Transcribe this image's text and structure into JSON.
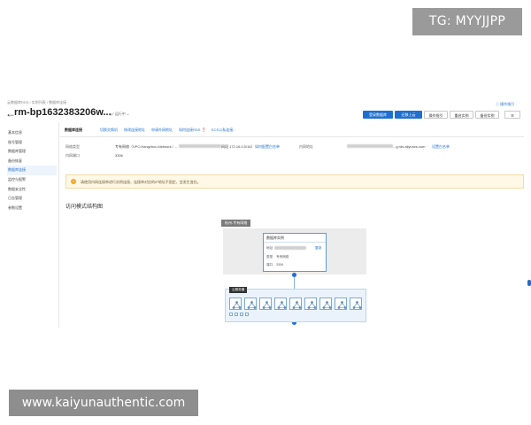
{
  "watermark": {
    "top": "TG: MYYJJPP",
    "bottom": "www.kaiyunauthentic.com"
  },
  "header": {
    "breadcrumb": "云数据库RDS / 实例列表 / 数据库连接",
    "instance_id": "rm-bp1632383206w...",
    "status": "运行中",
    "help": "操作指引"
  },
  "toolbar": {
    "buttons": [
      {
        "label": "登录数据库",
        "style": "primary"
      },
      {
        "label": "迁移上云",
        "style": "primary"
      },
      {
        "label": "操作指引",
        "style": "default"
      },
      {
        "label": "重启实例",
        "style": "default"
      },
      {
        "label": "备份实例",
        "style": "default"
      },
      {
        "label": "☰",
        "style": "default"
      }
    ]
  },
  "sidebar": {
    "items": [
      {
        "label": "基本信息",
        "active": false
      },
      {
        "label": "账号管理",
        "active": false
      },
      {
        "label": "数据库管理",
        "active": false
      },
      {
        "label": "备份恢复",
        "active": false
      },
      {
        "label": "数据库连接",
        "active": true
      },
      {
        "label": "监控与报警",
        "active": false
      },
      {
        "label": "数据安全性",
        "active": false
      },
      {
        "label": "日志管理",
        "active": false
      },
      {
        "label": "参数设置",
        "active": false
      }
    ]
  },
  "tabs": [
    {
      "label": "数据库连接",
      "active": true
    },
    {
      "label": "切换交换机",
      "active": false
    },
    {
      "label": "修改连接地址",
      "active": false
    },
    {
      "label": "申请外网地址",
      "active": false
    },
    {
      "label": "如何连接RDS",
      "active": false
    },
    {
      "label": "ECS公私连接...",
      "active": false
    }
  ],
  "connection_info": {
    "network_type_label": "网络类型",
    "network_type_value": "专有网络（VPC:Hangzhou-Network / ...",
    "network_suffix": "网段 172.16.0.0/16）",
    "network_link": "如何配置白名单",
    "internal_address_label": "内网地址",
    "internal_address_suffix": "...g.rds.aliyuncs.com",
    "internal_address_link": "设置白名单",
    "internal_port_label": "内网端口",
    "internal_port_value": "3306"
  },
  "banner": {
    "icon": "!",
    "text": "请使用内网连接串进行实例连接，连接串对应的IP地址不固定，会发生变化。"
  },
  "section": {
    "title": "访问模式结构图"
  },
  "diagram": {
    "vpc_tag": "杭州-专有网络",
    "db_card_title": "数据库实例",
    "db_row1_label": "地址",
    "db_row1_right": "复制",
    "db_row2_label": "类型",
    "db_row2_value": "专有网络",
    "db_row3_label": "端口",
    "db_row3_value": "3306",
    "app_tag": "云服务器",
    "server_count": 9
  },
  "colors": {
    "primary": "#1f6fd1",
    "banner_bg": "#fff8e6",
    "vpc_bg": "#ececec",
    "app_bg": "#eaf3fb"
  }
}
